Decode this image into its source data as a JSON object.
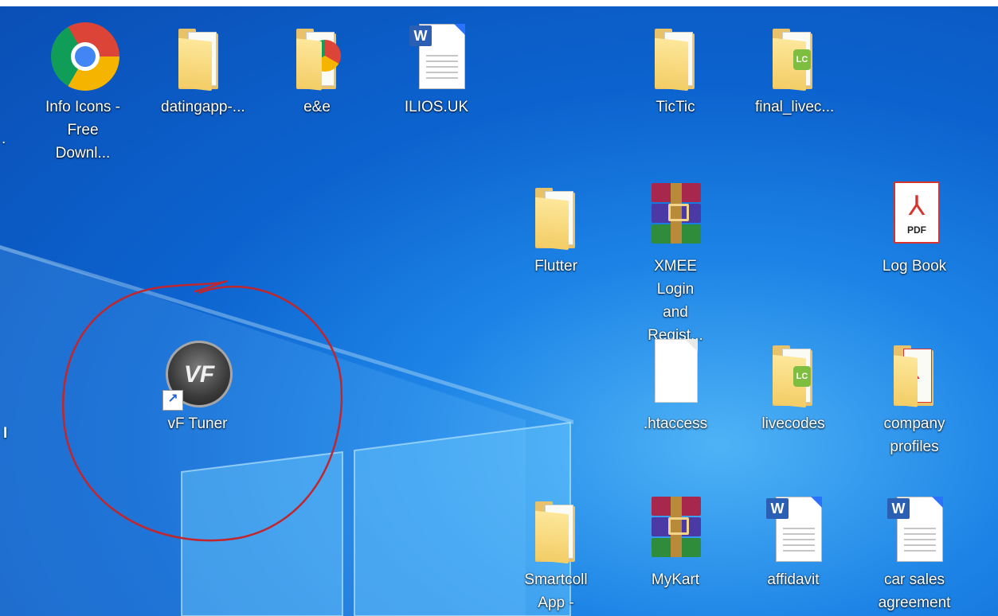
{
  "icons": [
    {
      "id": "info-icons",
      "type": "chrome",
      "label": "Info Icons -\nFree Downl..."
    },
    {
      "id": "datingapp",
      "type": "folder",
      "label": "datingapp-..."
    },
    {
      "id": "e-and-e",
      "type": "folder-chrome",
      "label": "e&e"
    },
    {
      "id": "ilios",
      "type": "word",
      "label": "ILIOS.UK"
    },
    {
      "id": "tictic",
      "type": "folder",
      "label": "TicTic"
    },
    {
      "id": "final-livec",
      "type": "folder-lc",
      "label": "final_livec..."
    },
    {
      "id": "flutter",
      "type": "folder",
      "label": "Flutter"
    },
    {
      "id": "xmee",
      "type": "winrar",
      "label": "XMEE Login\nand Regist..."
    },
    {
      "id": "log-book",
      "type": "pdf",
      "label": "Log Book",
      "pdf_text": "PDF"
    },
    {
      "id": "vf-tuner",
      "type": "vf",
      "label": "vF Tuner",
      "logo_text": "VF"
    },
    {
      "id": "htaccess",
      "type": "blank",
      "label": ".htaccess"
    },
    {
      "id": "livecodes",
      "type": "folder-lc",
      "label": "livecodes"
    },
    {
      "id": "company-profiles",
      "type": "folder-pdf",
      "label": "company\nprofiles"
    },
    {
      "id": "smartcoll",
      "type": "folder",
      "label": "Smartcoll\nApp -android"
    },
    {
      "id": "mykart",
      "type": "winrar",
      "label": "MyKart"
    },
    {
      "id": "affidavit",
      "type": "word",
      "label": "affidavit"
    },
    {
      "id": "car-sales",
      "type": "word",
      "label": "car sales\nagreement"
    }
  ],
  "edge_labels": {
    "left_dot": ".",
    "left_bar": "I"
  },
  "word_badge": "W",
  "lc_badge": "LC",
  "colors": {
    "annotation_circle": "#c0262d",
    "desktop_blue": "#0c63cf"
  }
}
